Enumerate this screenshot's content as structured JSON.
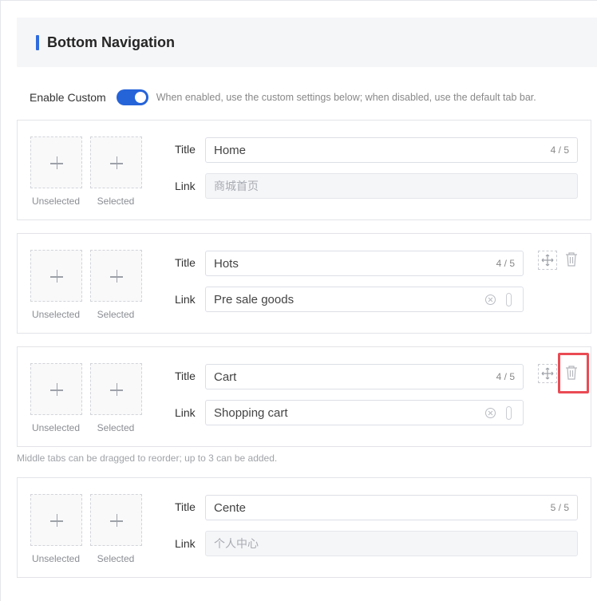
{
  "section": {
    "title": "Bottom Navigation"
  },
  "enable": {
    "label": "Enable Custom",
    "on": true,
    "hint": "When enabled, use the custom settings below; when disabled, use the default tab bar."
  },
  "labels": {
    "unselected": "Unselected",
    "selected": "Selected",
    "title": "Title",
    "link": "Link"
  },
  "tabs": [
    {
      "title": "Home",
      "counter": "4 / 5",
      "link": "商城首页",
      "link_editable": false,
      "actions": false
    },
    {
      "title": "Hots",
      "counter": "4 / 5",
      "link": "Pre sale goods",
      "link_editable": true,
      "actions": true
    },
    {
      "title": "Cart",
      "counter": "4 / 5",
      "link": "Shopping cart",
      "link_editable": true,
      "actions": true
    },
    {
      "title": "Cente",
      "counter": "5 / 5",
      "link": "个人中心",
      "link_editable": false,
      "actions": false
    }
  ],
  "tip": "Middle tabs can be dragged to reorder; up to 3 can be added.",
  "colors": {
    "accent": "#2563d9",
    "highlight": "#ea4b54"
  }
}
